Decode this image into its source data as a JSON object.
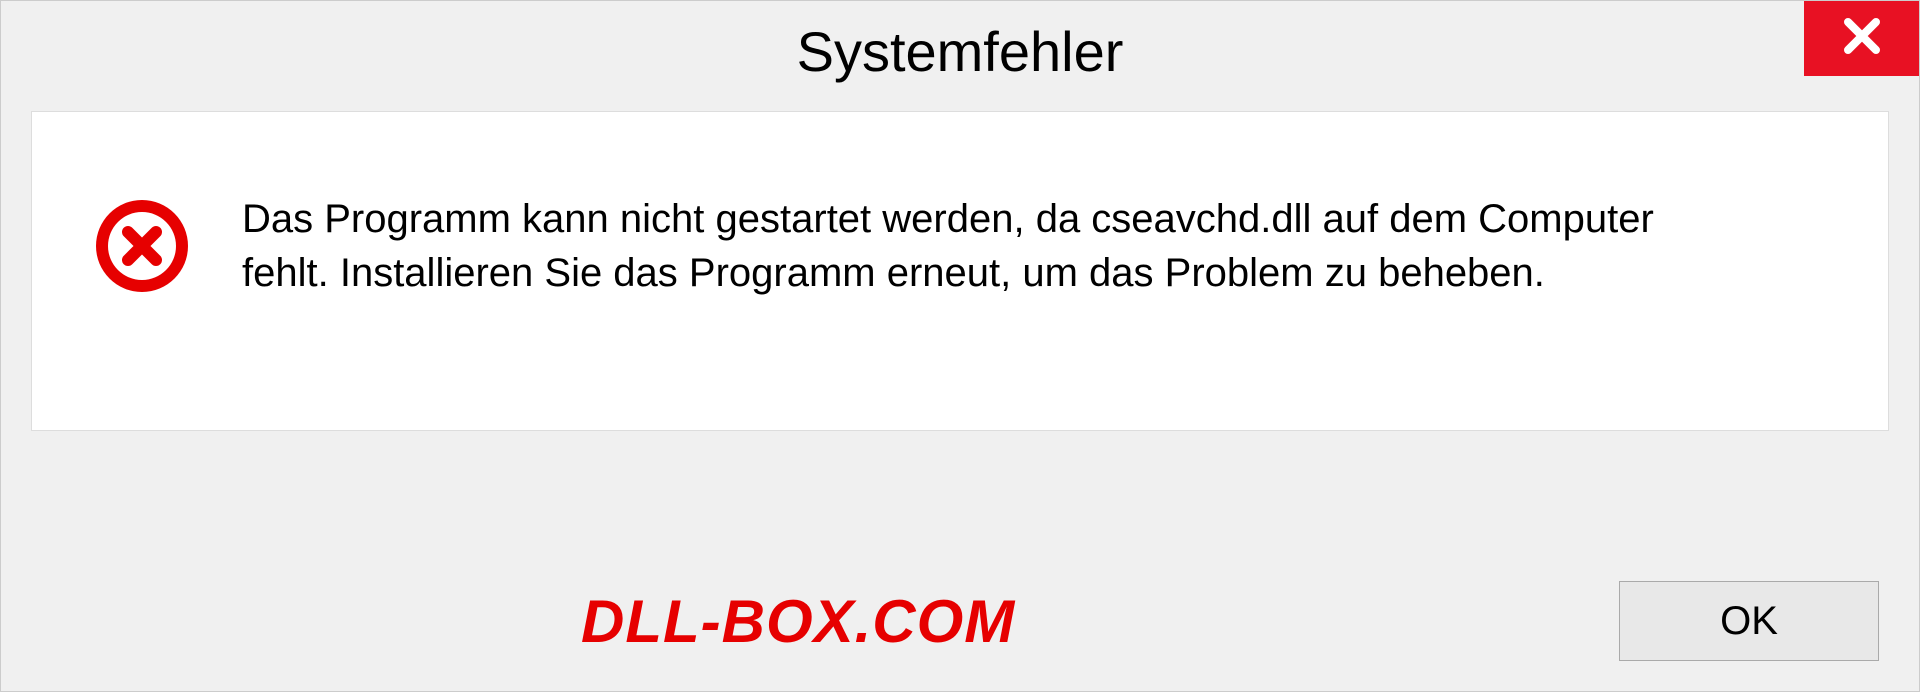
{
  "dialog": {
    "title": "Systemfehler",
    "message": "Das Programm kann nicht gestartet werden, da cseavchd.dll auf dem Computer fehlt. Installieren Sie das Programm erneut, um das Problem zu beheben.",
    "ok_label": "OK"
  },
  "watermark": "DLL-BOX.COM"
}
